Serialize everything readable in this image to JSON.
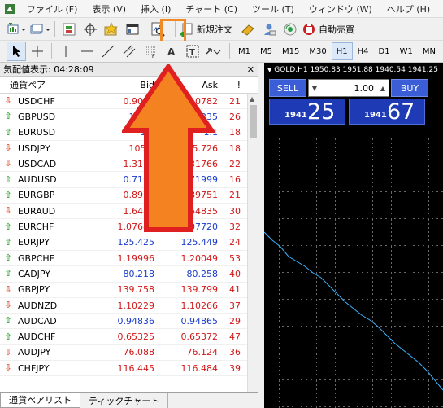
{
  "menu": [
    "ファイル (F)",
    "表示 (V)",
    "挿入 (I)",
    "チャート (C)",
    "ツール (T)",
    "ウィンドウ (W)",
    "ヘルプ (H)"
  ],
  "toolbar": {
    "new_order_label": "新規注文",
    "auto_trade_label": "自動売買"
  },
  "timeframes": [
    "M1",
    "M5",
    "M15",
    "M30",
    "H1",
    "H4",
    "D1",
    "W1",
    "MN"
  ],
  "active_timeframe": "H1",
  "market_watch": {
    "title": "気配値表示: 04:28:09",
    "headers": {
      "symbol": "通貨ペア",
      "bid": "Bid",
      "ask": "Ask",
      "spread": "!"
    },
    "rows": [
      {
        "symbol": "USDCHF",
        "dir": "down",
        "bid": "0.9076",
        "ask": "0.0782",
        "spread": "21",
        "bid_color": "red",
        "ask_color": "red"
      },
      {
        "symbol": "GBPUSD",
        "dir": "up",
        "bid": "1.323",
        "ask": "1.3235",
        "spread": "26",
        "bid_color": "blue",
        "ask_color": "blue"
      },
      {
        "symbol": "EURUSD",
        "dir": "up",
        "bid": "1.1",
        "ask": "1.1",
        "spread": "18",
        "bid_color": "blue",
        "ask_color": "blue"
      },
      {
        "symbol": "USDJPY",
        "dir": "down",
        "bid": "105.7",
        "ask": "105.726",
        "spread": "18",
        "bid_color": "red",
        "ask_color": "red"
      },
      {
        "symbol": "USDCAD",
        "dir": "down",
        "bid": "1.3174",
        "ask": "1.31766",
        "spread": "22",
        "bid_color": "red",
        "ask_color": "red"
      },
      {
        "symbol": "AUDUSD",
        "dir": "up",
        "bid": "0.7198",
        "ask": "0.71999",
        "spread": "16",
        "bid_color": "blue",
        "ask_color": "blue"
      },
      {
        "symbol": "EURGBP",
        "dir": "up",
        "bid": "0.8973",
        "ask": "0.89751",
        "spread": "21",
        "bid_color": "red",
        "ask_color": "red"
      },
      {
        "symbol": "EURAUD",
        "dir": "down",
        "bid": "1.6480",
        "ask": "1.64835",
        "spread": "30",
        "bid_color": "red",
        "ask_color": "red"
      },
      {
        "symbol": "EURCHF",
        "dir": "up",
        "bid": "1.07688",
        "ask": "1.07720",
        "spread": "32",
        "bid_color": "red",
        "ask_color": "blue"
      },
      {
        "symbol": "EURJPY",
        "dir": "up",
        "bid": "125.425",
        "ask": "125.449",
        "spread": "24",
        "bid_color": "blue",
        "ask_color": "blue"
      },
      {
        "symbol": "GBPCHF",
        "dir": "up",
        "bid": "1.19996",
        "ask": "1.20049",
        "spread": "53",
        "bid_color": "red",
        "ask_color": "red"
      },
      {
        "symbol": "CADJPY",
        "dir": "up",
        "bid": "80.218",
        "ask": "80.258",
        "spread": "40",
        "bid_color": "blue",
        "ask_color": "blue"
      },
      {
        "symbol": "GBPJPY",
        "dir": "down",
        "bid": "139.758",
        "ask": "139.799",
        "spread": "41",
        "bid_color": "red",
        "ask_color": "red"
      },
      {
        "symbol": "AUDNZD",
        "dir": "down",
        "bid": "1.10229",
        "ask": "1.10266",
        "spread": "37",
        "bid_color": "red",
        "ask_color": "red"
      },
      {
        "symbol": "AUDCAD",
        "dir": "up",
        "bid": "0.94836",
        "ask": "0.94865",
        "spread": "29",
        "bid_color": "blue",
        "ask_color": "blue"
      },
      {
        "symbol": "AUDCHF",
        "dir": "up",
        "bid": "0.65325",
        "ask": "0.65372",
        "spread": "47",
        "bid_color": "red",
        "ask_color": "red"
      },
      {
        "symbol": "AUDJPY",
        "dir": "down",
        "bid": "76.088",
        "ask": "76.124",
        "spread": "36",
        "bid_color": "red",
        "ask_color": "red"
      },
      {
        "symbol": "CHFJPY",
        "dir": "down",
        "bid": "116.445",
        "ask": "116.484",
        "spread": "39",
        "bid_color": "red",
        "ask_color": "red"
      }
    ],
    "tabs": [
      "通貨ペアリスト",
      "ティックチャート"
    ]
  },
  "chart": {
    "title": "GOLD,H1  1950.83  1951.88  1940.54  1941.25",
    "sell_label": "SELL",
    "buy_label": "BUY",
    "lot_value": "1.00",
    "sell_price_small": "1941",
    "sell_price_big": "25",
    "buy_price_small": "1941",
    "buy_price_big": "67"
  },
  "colors": {
    "highlight": "#f08a24",
    "arrow_fill": "#f58220",
    "arrow_stroke": "#e02020",
    "chart_bg": "#000000",
    "chart_line": "#3cb4ff"
  }
}
